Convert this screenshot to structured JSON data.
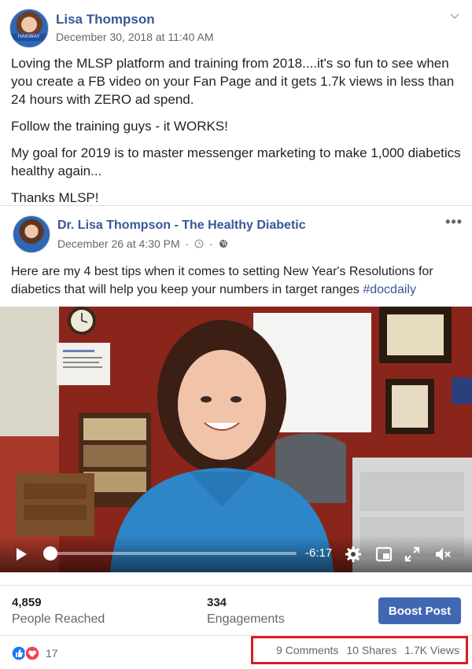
{
  "post": {
    "author": "Lisa Thompson",
    "avatar_badge": "HAKWAY",
    "timestamp": "December 30, 2018 at 11:40 AM",
    "paragraphs": [
      "Loving the MLSP platform and training from 2018....it's so fun to see when you create a FB video on your Fan Page and it gets 1.7k views in less than 24 hours with ZERO ad spend.",
      "Follow the training guys - it WORKS!",
      "My goal for 2019 is to master messenger marketing to make 1,000 diabetics healthy again...",
      "Thanks MLSP!"
    ]
  },
  "shared": {
    "page_name": "Dr. Lisa Thompson - The Healthy Diabetic",
    "date": "December 26 at 4:30 PM",
    "separator": "·",
    "text_before_tag": "Here are my 4 best tips when it comes to setting New Year's Resolutions for diabetics that will help you keep your numbers in target ranges ",
    "hashtag": "#docdaily",
    "more_label": "•••",
    "video": {
      "time_remaining": "-6:17",
      "progress": 0.03
    }
  },
  "stats": {
    "reached_value": "4,859",
    "reached_label": "People Reached",
    "engagements_value": "334",
    "engagements_label": "Engagements",
    "boost_label": "Boost Post"
  },
  "footer": {
    "reactions_count": "17",
    "comments": "9 Comments",
    "shares": "10 Shares",
    "views": "1.7K Views"
  },
  "colors": {
    "link": "#385898",
    "boost": "#4267b2",
    "highlight": "#d61f26"
  }
}
